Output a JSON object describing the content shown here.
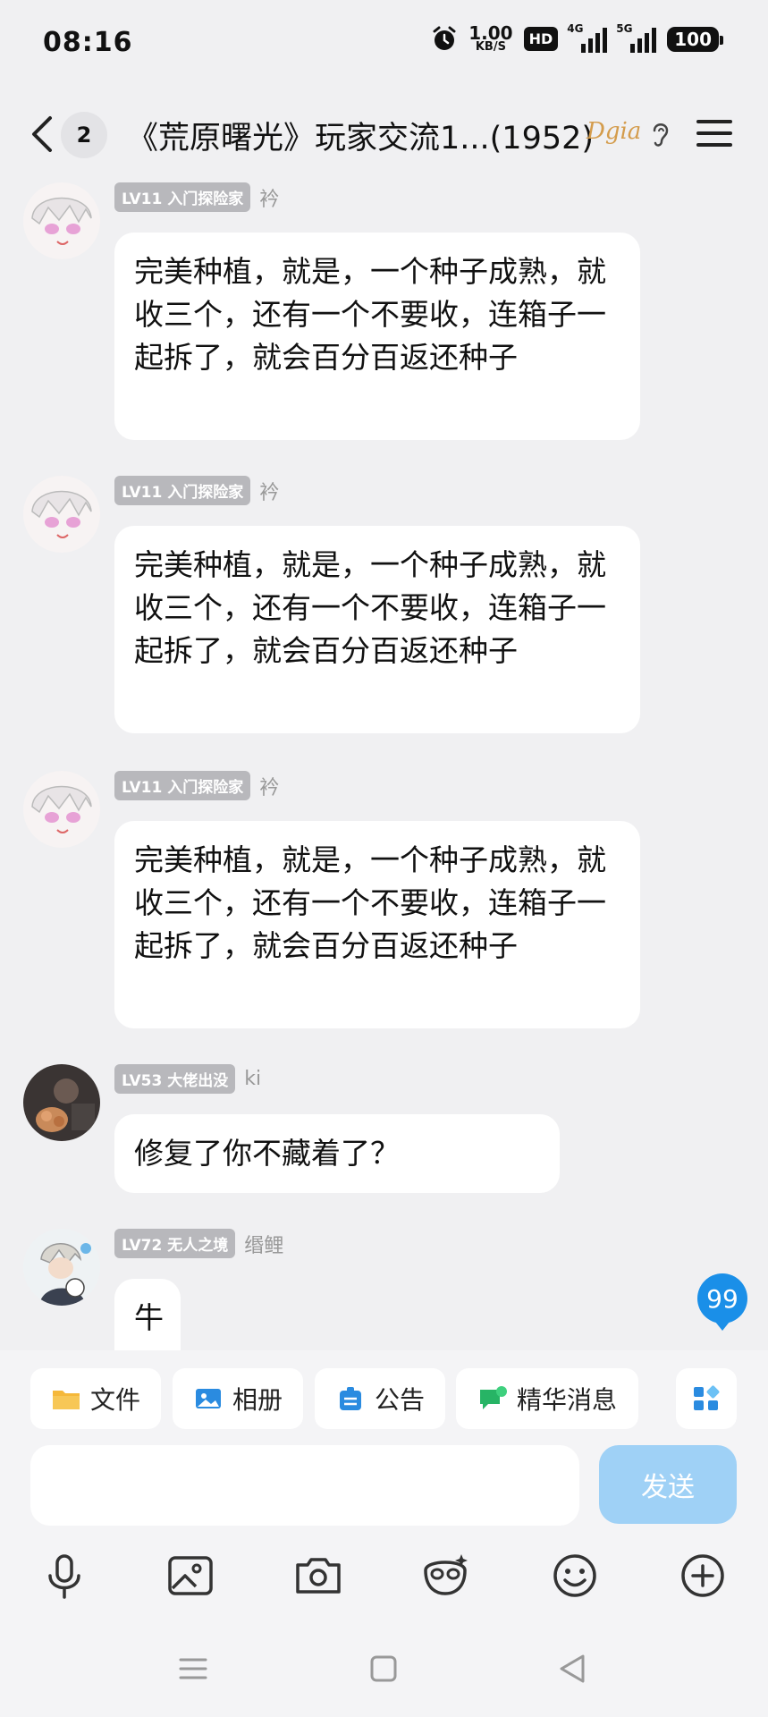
{
  "status_bar": {
    "time": "08:16",
    "net_speed_value": "1.00",
    "net_speed_unit": "KB/S",
    "hd_label": "HD",
    "sig1_label": "4G",
    "sig2_label": "5G",
    "battery": "100"
  },
  "header": {
    "unread_count": "2",
    "title": "《荒原曙光》玩家交流1...(1952)",
    "brand_text": "Dgia"
  },
  "messages": [
    {
      "badge": "LV11 入门探险家",
      "nick": "衿",
      "text": "完美种植，就是，一个种子成熟，就收三个，还有一个不要收，连箱子一起拆了，就会百分百返还种子"
    },
    {
      "badge": "LV11 入门探险家",
      "nick": "衿",
      "text": "完美种植，就是，一个种子成熟，就收三个，还有一个不要收，连箱子一起拆了，就会百分百返还种子"
    },
    {
      "badge": "LV11 入门探险家",
      "nick": "衿",
      "text": "完美种植，就是，一个种子成熟，就收三个，还有一个不要收，连箱子一起拆了，就会百分百返还种子"
    },
    {
      "badge": "LV53 大佬出没",
      "nick": "ki",
      "text": "修复了你不藏着了？"
    },
    {
      "badge": "LV72 无人之境",
      "nick": "缗鲤",
      "text": "牛"
    }
  ],
  "unread_badge": "99",
  "quick_actions": [
    "文件",
    "相册",
    "公告",
    "精华消息"
  ],
  "input": {
    "placeholder": "",
    "send_label": "发送"
  },
  "colors": {
    "accent": "#1a8fe8",
    "send_disabled": "#9fd1f6",
    "background": "#f0f0f2"
  }
}
